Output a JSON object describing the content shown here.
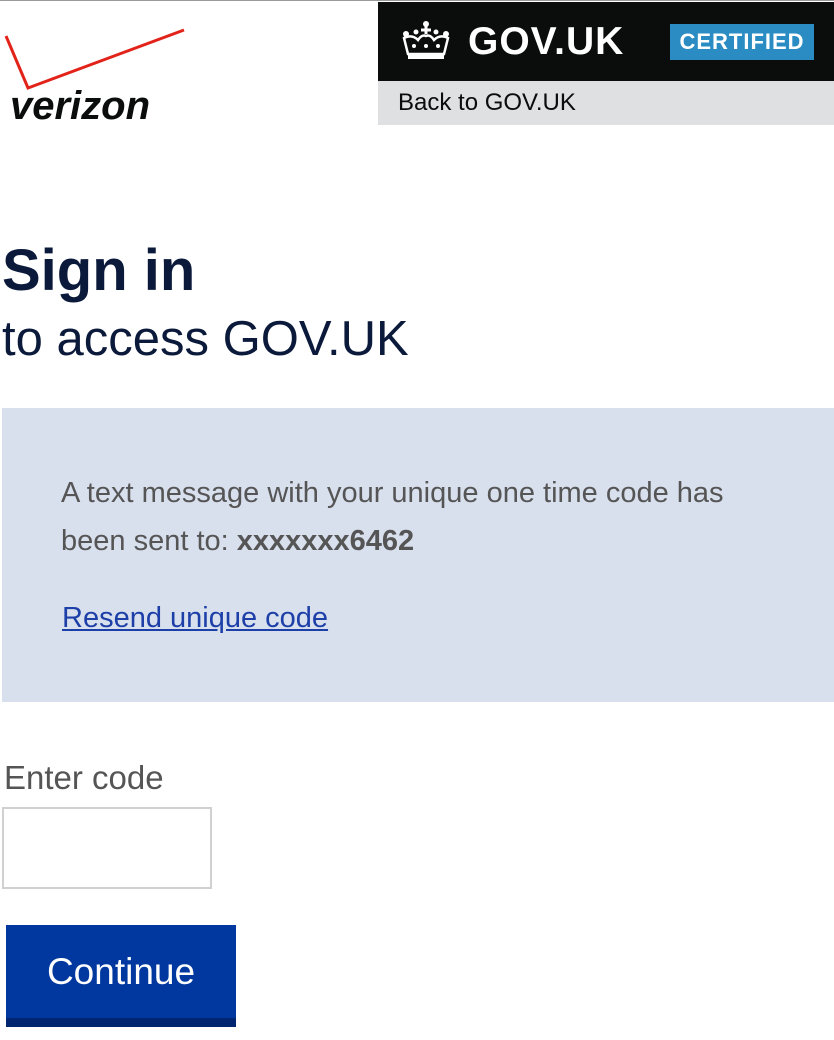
{
  "brand": {
    "logo_text": "verizon",
    "logo_accent_color": "#e2231a"
  },
  "gov_header": {
    "title": "GOV.UK",
    "badge": "CERTIFIED",
    "crown_icon": "crown-icon",
    "background_color": "#0b0c0c",
    "badge_color": "#2b8cc4"
  },
  "back_bar": {
    "link_label": "Back to GOV.UK"
  },
  "page": {
    "heading": "Sign in",
    "subheading": "to access GOV.UK"
  },
  "info_panel": {
    "message_text": "A text message with your unique one time code has been sent to: ",
    "masked_number": "xxxxxxx6462",
    "resend_link": "Resend unique code",
    "background_color": "#d8dfed"
  },
  "form": {
    "code_label": "Enter code",
    "code_value": "",
    "continue_label": "Continue",
    "button_color": "#0038a0"
  }
}
